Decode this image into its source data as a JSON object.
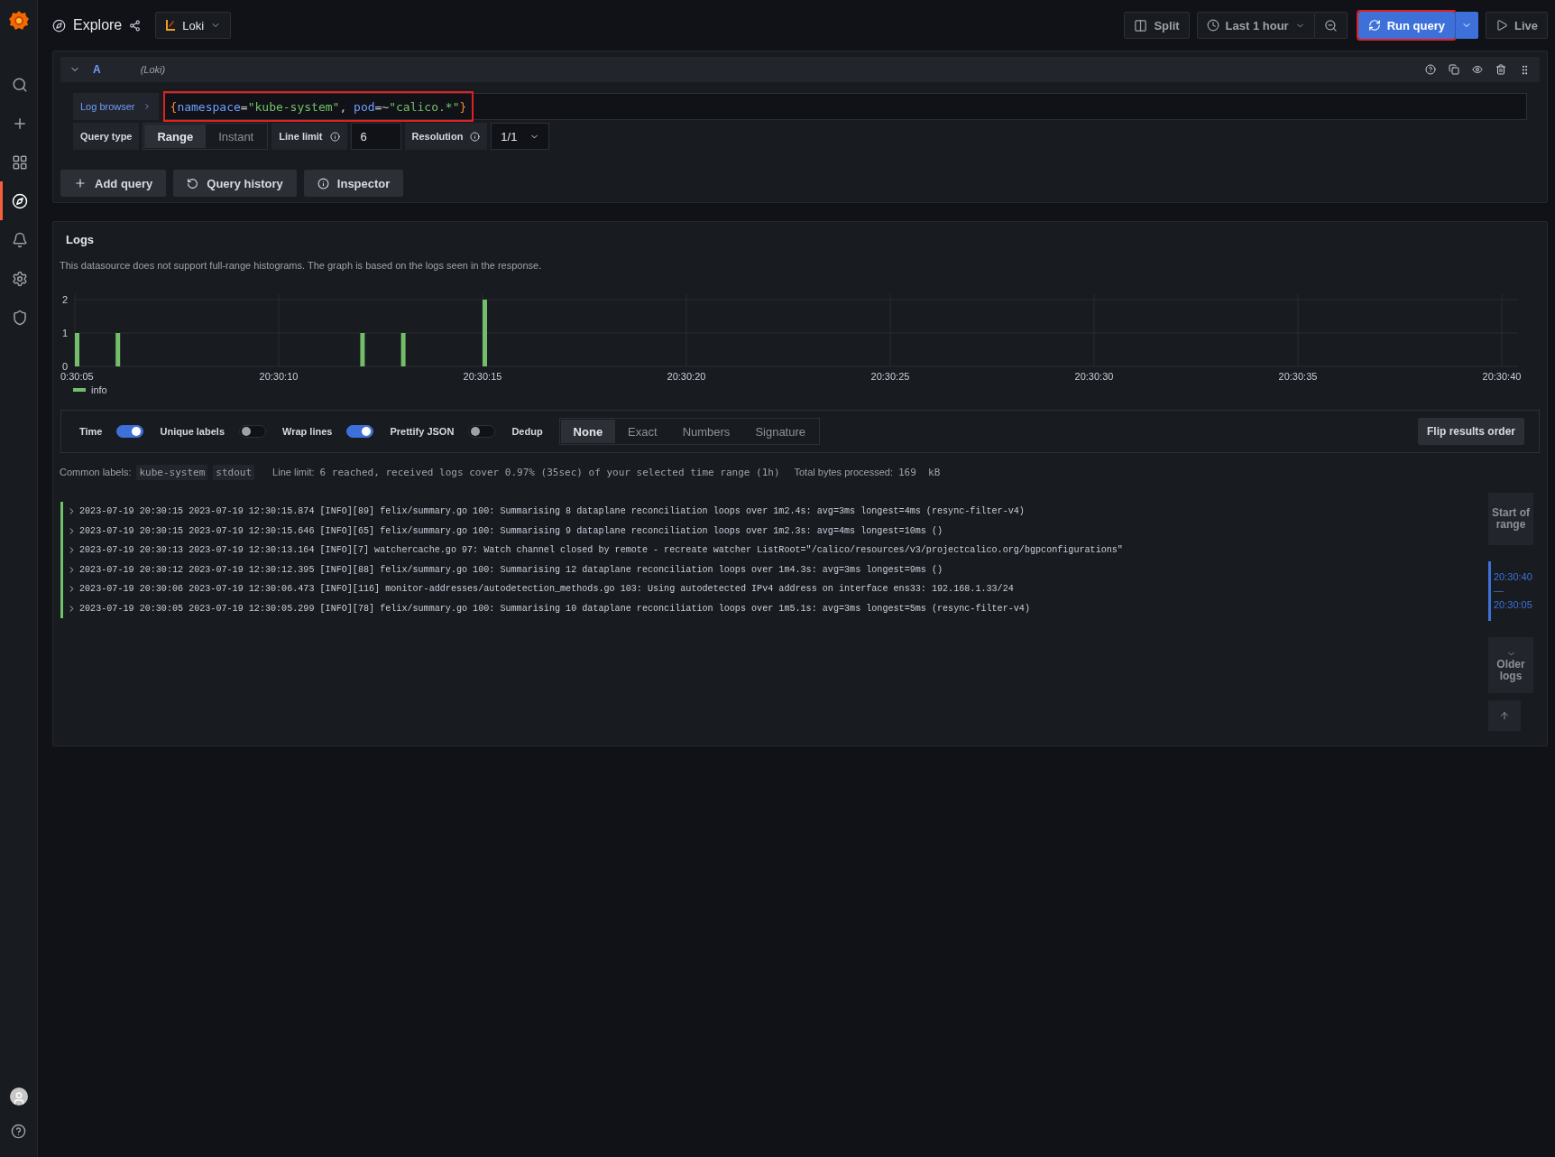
{
  "sidebar": {
    "items": [
      {
        "kind": "search",
        "selected": false
      },
      {
        "kind": "create",
        "selected": false
      },
      {
        "kind": "dashboards",
        "selected": false
      },
      {
        "kind": "explore",
        "selected": true
      },
      {
        "kind": "alerting",
        "selected": false
      },
      {
        "kind": "settings",
        "selected": false
      },
      {
        "kind": "shield",
        "selected": false
      }
    ]
  },
  "toolbar": {
    "title": "Explore",
    "datasource": "Loki",
    "split": "Split",
    "time_range": "Last 1 hour",
    "run_query": "Run query",
    "live": "Live"
  },
  "query": {
    "expanded": true,
    "ref": "A",
    "datasource": "(Loki)",
    "log_browser": "Log browser",
    "tokens": [
      {
        "kind": "brace",
        "text": "{"
      },
      {
        "kind": "label",
        "text": "namespace"
      },
      {
        "kind": "op",
        "text": "="
      },
      {
        "kind": "string",
        "text": "\"kube-system\""
      },
      {
        "kind": "punct",
        "text": ", "
      },
      {
        "kind": "label",
        "text": "pod"
      },
      {
        "kind": "op",
        "text": "=~"
      },
      {
        "kind": "string",
        "text": "\"calico.*\""
      },
      {
        "kind": "brace",
        "text": "}"
      }
    ],
    "query_type_label": "Query type",
    "query_types": [
      {
        "label": "Range",
        "selected": true
      },
      {
        "label": "Instant",
        "selected": false
      }
    ],
    "line_limit_label": "Line limit",
    "line_limit": "6",
    "resolution_label": "Resolution",
    "resolution": "1/1"
  },
  "query_actions": [
    "Add query",
    "Query history",
    "Inspector"
  ],
  "logs": {
    "title": "Logs",
    "notice": "This datasource does not support full-range histograms. The graph is based on the logs seen in the response.",
    "chart_data": {
      "type": "bar",
      "categories": [
        "0:30:05",
        null,
        null,
        null,
        null,
        "20:30:10",
        null,
        null,
        null,
        null,
        "20:30:15",
        null,
        null,
        null,
        null,
        "20:30:20",
        null,
        null,
        null,
        null,
        "20:30:25",
        null,
        null,
        null,
        null,
        "20:30:30",
        null,
        null,
        null,
        null,
        "20:30:35",
        null,
        null,
        null,
        null,
        "20:30:40"
      ],
      "series": [
        {
          "name": "info",
          "color": "#73bf69",
          "values": [
            1,
            1,
            0,
            0,
            0,
            0,
            0,
            1,
            1,
            0,
            2,
            0,
            0,
            0,
            0,
            0,
            0,
            0,
            0,
            0,
            0,
            0,
            0,
            0,
            0,
            0,
            0,
            0,
            0,
            0,
            0,
            0,
            0,
            0,
            0,
            0
          ]
        }
      ],
      "ylim": [
        0,
        2
      ],
      "yticks": [
        0,
        1,
        2
      ],
      "grid": true
    },
    "toggles": [
      {
        "label": "Time",
        "on": true
      },
      {
        "label": "Unique labels",
        "on": false
      },
      {
        "label": "Wrap lines",
        "on": true
      },
      {
        "label": "Prettify JSON",
        "on": false
      }
    ],
    "dedup_label": "Dedup",
    "dedup_options": [
      {
        "label": "None",
        "selected": true
      },
      {
        "label": "Exact",
        "selected": false
      },
      {
        "label": "Numbers",
        "selected": false
      },
      {
        "label": "Signature",
        "selected": false
      }
    ],
    "flip": "Flip results order",
    "common_labels_label": "Common labels:",
    "common_labels": [
      "kube-system",
      "stdout"
    ],
    "line_limit_label": "Line limit:",
    "line_limit_text": "6 reached, received logs cover 0.97% (35sec) of your selected time range (1h)",
    "bytes_label": "Total bytes processed:",
    "bytes": "169  kB",
    "rows": [
      "2023-07-19 20:30:15 2023-07-19 12:30:15.874 [INFO][89] felix/summary.go 100: Summarising 8 dataplane reconciliation loops over 1m2.4s: avg=3ms longest=4ms (resync-filter-v4)",
      "2023-07-19 20:30:15 2023-07-19 12:30:15.646 [INFO][65] felix/summary.go 100: Summarising 9 dataplane reconciliation loops over 1m2.3s: avg=4ms longest=10ms ()",
      "2023-07-19 20:30:13 2023-07-19 12:30:13.164 [INFO][7] watchercache.go 97: Watch channel closed by remote - recreate watcher ListRoot=\"/calico/resources/v3/projectcalico.org/bgpconfigurations\"",
      "2023-07-19 20:30:12 2023-07-19 12:30:12.395 [INFO][88] felix/summary.go 100: Summarising 12 dataplane reconciliation loops over 1m4.3s: avg=3ms longest=9ms ()",
      "2023-07-19 20:30:06 2023-07-19 12:30:06.473 [INFO][116] monitor-addresses/autodetection_methods.go 103: Using autodetected IPv4 address on interface ens33: 192.168.1.33/24",
      "2023-07-19 20:30:05 2023-07-19 12:30:05.299 [INFO][78] felix/summary.go 100: Summarising 10 dataplane reconciliation loops over 1m5.1s: avg=3ms longest=5ms (resync-filter-v4)"
    ],
    "start_of_range": "Start of range",
    "range": "20:30:40 — 20:30:05",
    "older_logs": "Older logs"
  }
}
